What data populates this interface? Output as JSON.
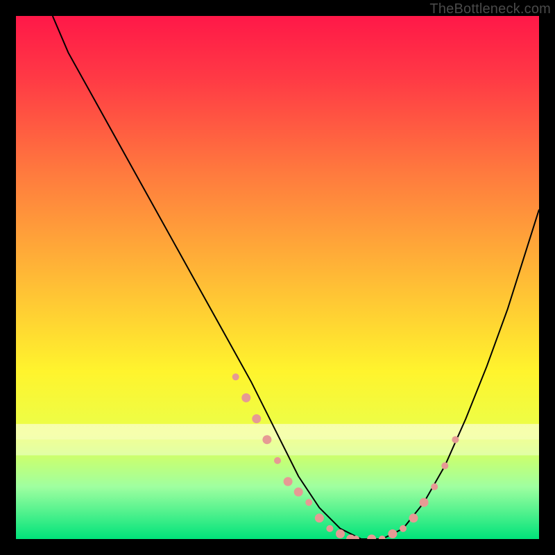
{
  "attribution": "TheBottleneck.com",
  "chart_data": {
    "type": "line",
    "title": "",
    "xlabel": "",
    "ylabel": "",
    "xlim": [
      0,
      100
    ],
    "ylim": [
      0,
      100
    ],
    "grid": false,
    "legend": false,
    "background_gradient": {
      "stops": [
        {
          "offset": 0.0,
          "color": "#ff1848"
        },
        {
          "offset": 0.12,
          "color": "#ff3a45"
        },
        {
          "offset": 0.3,
          "color": "#ff7a3e"
        },
        {
          "offset": 0.5,
          "color": "#ffba36"
        },
        {
          "offset": 0.68,
          "color": "#fff42d"
        },
        {
          "offset": 0.8,
          "color": "#eaff4a"
        },
        {
          "offset": 0.9,
          "color": "#9fffa0"
        },
        {
          "offset": 1.0,
          "color": "#00e37a"
        }
      ]
    },
    "white_bands_y": [
      {
        "y0": 78,
        "y1": 81,
        "alpha": 0.55
      },
      {
        "y0": 81,
        "y1": 84,
        "alpha": 0.4
      }
    ],
    "series": [
      {
        "name": "curve",
        "stroke": "#000000",
        "x": [
          7,
          10,
          15,
          20,
          25,
          30,
          35,
          40,
          45,
          50,
          54,
          58,
          62,
          66,
          70,
          74,
          78,
          82,
          86,
          90,
          94,
          100
        ],
        "y": [
          100,
          93,
          84,
          75,
          66,
          57,
          48,
          39,
          30,
          20,
          12,
          6,
          2,
          0,
          0,
          2,
          7,
          14,
          23,
          33,
          44,
          63
        ]
      }
    ],
    "markers": {
      "color": "#e69a94",
      "radius_small": 5,
      "radius_large": 6.5,
      "points_small": [
        {
          "x": 42,
          "y": 31
        },
        {
          "x": 50,
          "y": 15
        },
        {
          "x": 56,
          "y": 7
        },
        {
          "x": 60,
          "y": 2
        },
        {
          "x": 65,
          "y": 0
        },
        {
          "x": 70,
          "y": 0
        },
        {
          "x": 74,
          "y": 2
        },
        {
          "x": 80,
          "y": 10
        },
        {
          "x": 82,
          "y": 14
        },
        {
          "x": 84,
          "y": 19
        }
      ],
      "points_large": [
        {
          "x": 44,
          "y": 27
        },
        {
          "x": 46,
          "y": 23
        },
        {
          "x": 48,
          "y": 19
        },
        {
          "x": 52,
          "y": 11
        },
        {
          "x": 54,
          "y": 9
        },
        {
          "x": 58,
          "y": 4
        },
        {
          "x": 62,
          "y": 1
        },
        {
          "x": 64,
          "y": 0
        },
        {
          "x": 68,
          "y": 0
        },
        {
          "x": 72,
          "y": 1
        },
        {
          "x": 76,
          "y": 4
        },
        {
          "x": 78,
          "y": 7
        }
      ]
    }
  }
}
